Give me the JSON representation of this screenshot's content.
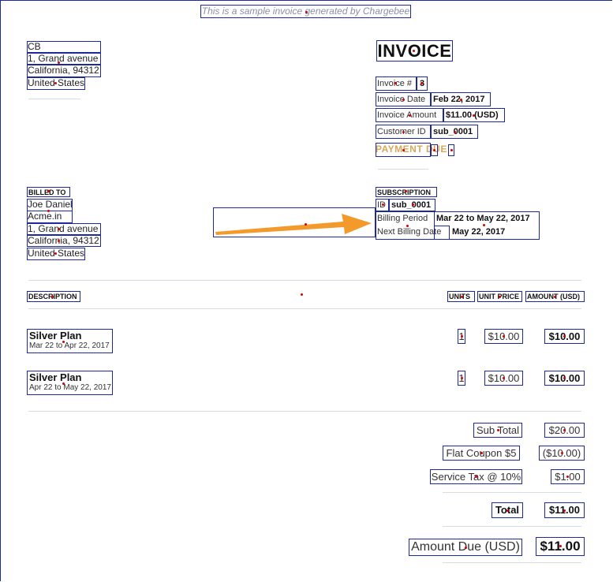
{
  "sample_note": "This is a sample invoice generated by Chargebee",
  "seller": {
    "name": "CB",
    "line1": "1, Grand avenue",
    "line2": "California, 94312",
    "country": "United States"
  },
  "invoice": {
    "title": "INVOICE",
    "number_label": "Invoice #",
    "number_value": "3",
    "date_label": "Invoice Date",
    "date_value": "Feb 22, 2017",
    "amount_label": "Invoice Amount",
    "amount_value": "$11.00 (USD)",
    "customer_label": "Customer ID",
    "customer_value": "sub_0001",
    "status_text": "PAYMENT DUE"
  },
  "billed_to": {
    "heading": "BILLED TO",
    "name": "Joe Daniel",
    "company": "Acme.in",
    "line1": "1, Grand avenue",
    "line2": "California, 94312",
    "country": "United States"
  },
  "subscription": {
    "heading": "SUBSCRIPTION",
    "id_label": "ID",
    "id_value": "sub_0001",
    "period_label": "Billing Period",
    "period_value": "Mar 22 to May 22, 2017",
    "next_label": "Next Billing Date",
    "next_value": "May 22, 2017"
  },
  "table": {
    "headers": {
      "description": "DESCRIPTION",
      "units": "UNITS",
      "unit_price": "UNIT PRICE",
      "amount": "AMOUNT (USD)"
    },
    "rows": [
      {
        "plan": "Silver Plan",
        "period": "Mar 22 to Apr 22, 2017",
        "units": "1",
        "unit_price": "$10.00",
        "amount": "$10.00"
      },
      {
        "plan": "Silver Plan",
        "period": "Apr 22 to May 22, 2017",
        "units": "1",
        "unit_price": "$10.00",
        "amount": "$10.00"
      }
    ]
  },
  "totals": {
    "subtotal_label": "Sub Total",
    "subtotal_value": "$20.00",
    "coupon_label": "Flat Coupon $5",
    "coupon_value": "($10.00)",
    "tax_label": "Service Tax @ 10%",
    "tax_value": "$1.00",
    "total_label": "Total",
    "total_value": "$11.00",
    "due_label": "Amount Due (USD)",
    "due_value": "$11.00"
  },
  "colors": {
    "outline": "#1f2a9a",
    "arrow": "#f39a2b",
    "status": "#d8a85a",
    "marker": "#d40000"
  }
}
